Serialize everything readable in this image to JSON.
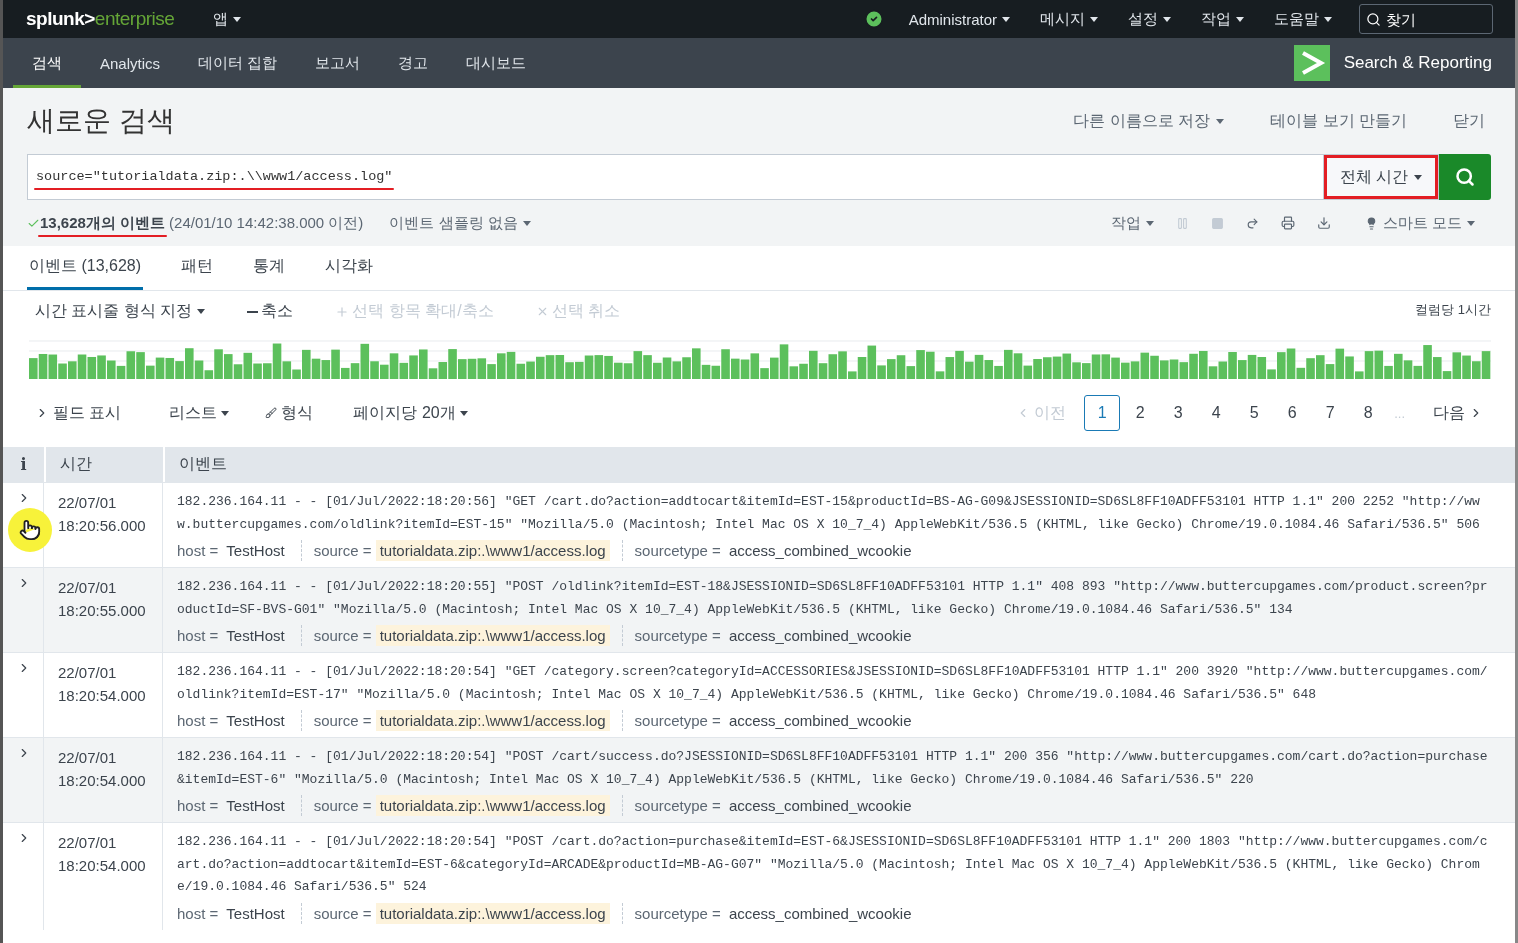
{
  "top_bar": {
    "logo_brand": "splunk>",
    "logo_product": "enterprise",
    "app_menu": "앱",
    "status_ok": true,
    "menus": [
      "Administrator",
      "메시지",
      "설정",
      "작업",
      "도움말"
    ],
    "search_placeholder": "찾기"
  },
  "app_nav": {
    "items": [
      {
        "label": "검색",
        "selected": true
      },
      {
        "label": "Analytics",
        "selected": false
      },
      {
        "label": "데이터 집합",
        "selected": false
      },
      {
        "label": "보고서",
        "selected": false
      },
      {
        "label": "경고",
        "selected": false
      },
      {
        "label": "대시보드",
        "selected": false
      }
    ],
    "app_title": "Search & Reporting"
  },
  "page": {
    "title": "새로운 검색",
    "actions": [
      {
        "label": "다른 이름으로 저장",
        "dropdown": true
      },
      {
        "label": "테이블 보기 만들기",
        "dropdown": false
      },
      {
        "label": "닫기",
        "dropdown": false
      }
    ]
  },
  "search": {
    "query": "source=\"tutorialdata.zip:.\\\\www1/access.log\"",
    "time_range": "전체 시간"
  },
  "status": {
    "done": true,
    "count": "13,628개의 이벤트",
    "time": "(24/01/10 14:42:38.000 이전)",
    "sampling": "이벤트 샘플링 없음",
    "job": "작업",
    "job_icons": [
      {
        "kind": "pause",
        "disabled": true
      },
      {
        "kind": "stop",
        "disabled": true
      },
      {
        "kind": "share",
        "disabled": false
      },
      {
        "kind": "print",
        "disabled": false
      },
      {
        "kind": "export",
        "disabled": false
      }
    ],
    "mode": "스마트 모드"
  },
  "result_tabs": [
    {
      "label": "이벤트 (13,628)",
      "selected": true
    },
    {
      "label": "패턴",
      "selected": false
    },
    {
      "label": "통계",
      "selected": false
    },
    {
      "label": "시각화",
      "selected": false
    }
  ],
  "timeline": {
    "format": "시간 표시줄 형식 지정",
    "actions": [
      {
        "kind": "minus",
        "label": "축소",
        "disabled": false
      },
      {
        "kind": "plus",
        "label": "선택 항목 확대/축소",
        "disabled": true
      },
      {
        "kind": "x",
        "label": "선택 취소",
        "disabled": true
      }
    ],
    "scale": "컬럼당 1시간"
  },
  "list_controls": {
    "fields": "필드 표시",
    "list": "리스트",
    "format": "형식",
    "per_page": "페이지당 20개"
  },
  "pagination": {
    "prev": "이전",
    "pages": [
      {
        "label": "1",
        "selected": true
      },
      {
        "label": "2",
        "selected": false
      },
      {
        "label": "3",
        "selected": false
      },
      {
        "label": "4",
        "selected": false
      },
      {
        "label": "5",
        "selected": false
      },
      {
        "label": "6",
        "selected": false
      },
      {
        "label": "7",
        "selected": false
      },
      {
        "label": "8",
        "selected": false
      }
    ],
    "ellipsis": "...",
    "next": "다음"
  },
  "table": {
    "columns": [
      "i",
      "시간",
      "이벤트"
    ],
    "field_separator": "=",
    "rows": [
      {
        "date": "22/07/01",
        "time": "18:20:56.000",
        "lines": [
          "182.236.164.11 - - [01/Jul/2022:18:20:56] \"GET /cart.do?action=addtocart&itemId=EST-15&productId=BS-AG-G09&JSESSIONID=SD6SL8FF10ADFF53101 HTTP 1.1\" 200 2252 \"http://ww",
          "w.buttercupgames.com/oldlink?itemId=EST-15\" \"Mozilla/5.0 (Macintosh; Intel Mac OS X 10_7_4) AppleWebKit/536.5 (KHTML, like Gecko) Chrome/19.0.1084.46 Safari/536.5\" 506"
        ],
        "fields": [
          {
            "key": "host",
            "value": "TestHost",
            "highlighted": false
          },
          {
            "key": "source",
            "value": "tutorialdata.zip:.\\www1/access.log",
            "highlighted": true
          },
          {
            "key": "sourcetype",
            "value": "access_combined_wcookie",
            "highlighted": false
          }
        ]
      },
      {
        "date": "22/07/01",
        "time": "18:20:55.000",
        "lines": [
          "182.236.164.11 - - [01/Jul/2022:18:20:55] \"POST /oldlink?itemId=EST-18&JSESSIONID=SD6SL8FF10ADFF53101 HTTP 1.1\" 408 893 \"http://www.buttercupgames.com/product.screen?pr",
          "oductId=SF-BVS-G01\" \"Mozilla/5.0 (Macintosh; Intel Mac OS X 10_7_4) AppleWebKit/536.5 (KHTML, like Gecko) Chrome/19.0.1084.46 Safari/536.5\" 134"
        ],
        "fields": [
          {
            "key": "host",
            "value": "TestHost",
            "highlighted": false
          },
          {
            "key": "source",
            "value": "tutorialdata.zip:.\\www1/access.log",
            "highlighted": true
          },
          {
            "key": "sourcetype",
            "value": "access_combined_wcookie",
            "highlighted": false
          }
        ]
      },
      {
        "date": "22/07/01",
        "time": "18:20:54.000",
        "lines": [
          "182.236.164.11 - - [01/Jul/2022:18:20:54] \"GET /category.screen?categoryId=ACCESSORIES&JSESSIONID=SD6SL8FF10ADFF53101 HTTP 1.1\" 200 3920 \"http://www.buttercupgames.com/",
          "oldlink?itemId=EST-17\" \"Mozilla/5.0 (Macintosh; Intel Mac OS X 10_7_4) AppleWebKit/536.5 (KHTML, like Gecko) Chrome/19.0.1084.46 Safari/536.5\" 648"
        ],
        "fields": [
          {
            "key": "host",
            "value": "TestHost",
            "highlighted": false
          },
          {
            "key": "source",
            "value": "tutorialdata.zip:.\\www1/access.log",
            "highlighted": true
          },
          {
            "key": "sourcetype",
            "value": "access_combined_wcookie",
            "highlighted": false
          }
        ]
      },
      {
        "date": "22/07/01",
        "time": "18:20:54.000",
        "lines": [
          "182.236.164.11 - - [01/Jul/2022:18:20:54] \"POST /cart/success.do?JSESSIONID=SD6SL8FF10ADFF53101 HTTP 1.1\" 200 356 \"http://www.buttercupgames.com/cart.do?action=purchase",
          "&itemId=EST-6\" \"Mozilla/5.0 (Macintosh; Intel Mac OS X 10_7_4) AppleWebKit/536.5 (KHTML, like Gecko) Chrome/19.0.1084.46 Safari/536.5\" 220"
        ],
        "fields": [
          {
            "key": "host",
            "value": "TestHost",
            "highlighted": false
          },
          {
            "key": "source",
            "value": "tutorialdata.zip:.\\www1/access.log",
            "highlighted": true
          },
          {
            "key": "sourcetype",
            "value": "access_combined_wcookie",
            "highlighted": false
          }
        ]
      },
      {
        "date": "22/07/01",
        "time": "18:20:54.000",
        "lines": [
          "182.236.164.11 - - [01/Jul/2022:18:20:54] \"POST /cart.do?action=purchase&itemId=EST-6&JSESSIONID=SD6SL8FF10ADFF53101 HTTP 1.1\" 200 1803 \"http://www.buttercupgames.com/c",
          "art.do?action=addtocart&itemId=EST-6&categoryId=ARCADE&productId=MB-AG-G07\" \"Mozilla/5.0 (Macintosh; Intel Mac OS X 10_7_4) AppleWebKit/536.5 (KHTML, like Gecko) Chrom",
          "e/19.0.1084.46 Safari/536.5\" 524"
        ],
        "fields": [
          {
            "key": "host",
            "value": "TestHost",
            "highlighted": false
          },
          {
            "key": "source",
            "value": "tutorialdata.zip:.\\www1/access.log",
            "highlighted": true
          },
          {
            "key": "sourcetype",
            "value": "access_combined_wcookie",
            "highlighted": false
          }
        ]
      }
    ]
  }
}
